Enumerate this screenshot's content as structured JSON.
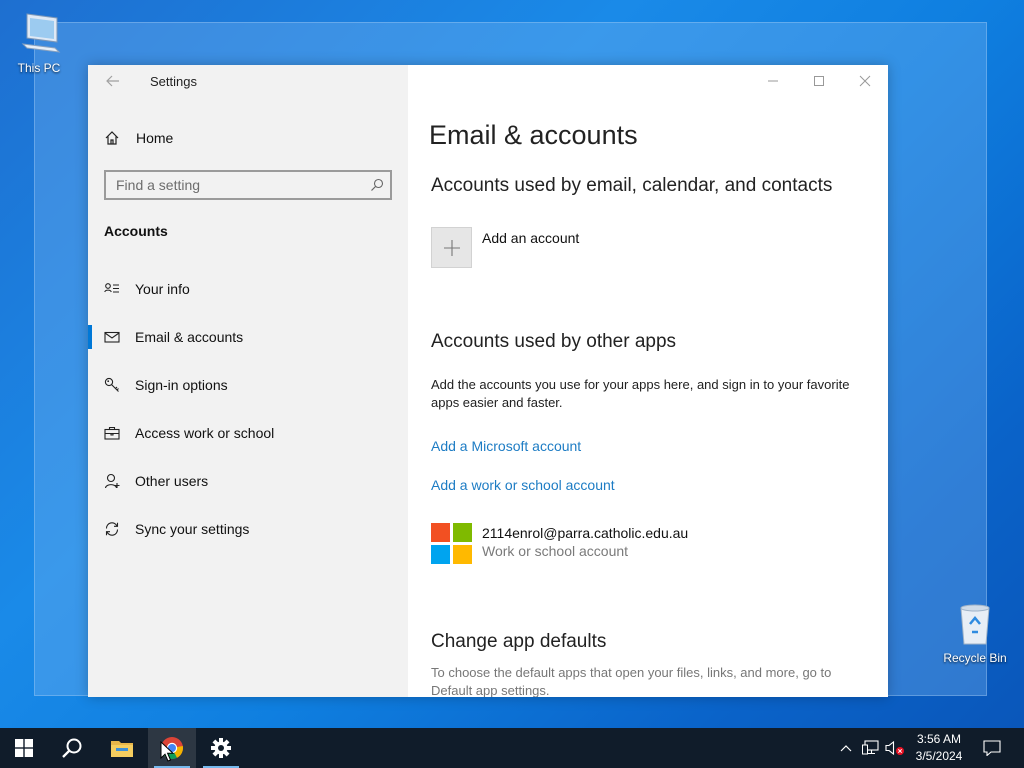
{
  "desktop": {
    "this_pc_label": "This PC",
    "recycle_bin_label": "Recycle Bin"
  },
  "window": {
    "title": "Settings",
    "sidebar": {
      "home_label": "Home",
      "search_placeholder": "Find a setting",
      "section_heading": "Accounts",
      "items": [
        {
          "label": "Your info",
          "icon": "contact-card-icon",
          "active": false
        },
        {
          "label": "Email & accounts",
          "icon": "mail-icon",
          "active": true
        },
        {
          "label": "Sign-in options",
          "icon": "key-icon",
          "active": false
        },
        {
          "label": "Access work or school",
          "icon": "briefcase-icon",
          "active": false
        },
        {
          "label": "Other users",
          "icon": "person-icon",
          "active": false
        },
        {
          "label": "Sync your settings",
          "icon": "sync-icon",
          "active": false
        }
      ]
    },
    "main": {
      "page_title": "Email & accounts",
      "email_section_heading": "Accounts used by email, calendar, and contacts",
      "add_account_label": "Add an account",
      "other_apps_heading": "Accounts used by other apps",
      "other_apps_description": "Add the accounts you use for your apps here, and sign in to your favorite apps easier and faster.",
      "add_microsoft_account_link": "Add a Microsoft account",
      "add_work_school_link": "Add a work or school account",
      "account": {
        "email": "2114enrol@parra.catholic.edu.au",
        "type": "Work or school account"
      },
      "app_defaults_heading": "Change app defaults",
      "app_defaults_description": "To choose the default apps that open your files, links, and more, go to Default app settings."
    }
  },
  "taskbar": {
    "apps": [
      "start-button",
      "search-button",
      "file-explorer",
      "chrome",
      "settings"
    ],
    "clock_time": "3:56 AM",
    "clock_date": "3/5/2024"
  },
  "colors": {
    "accent": "#0078d7",
    "link": "#1d7cc4",
    "ms_red": "#f25022",
    "ms_green": "#7fba00",
    "ms_blue": "#00a4ef",
    "ms_yellow": "#ffb900"
  }
}
